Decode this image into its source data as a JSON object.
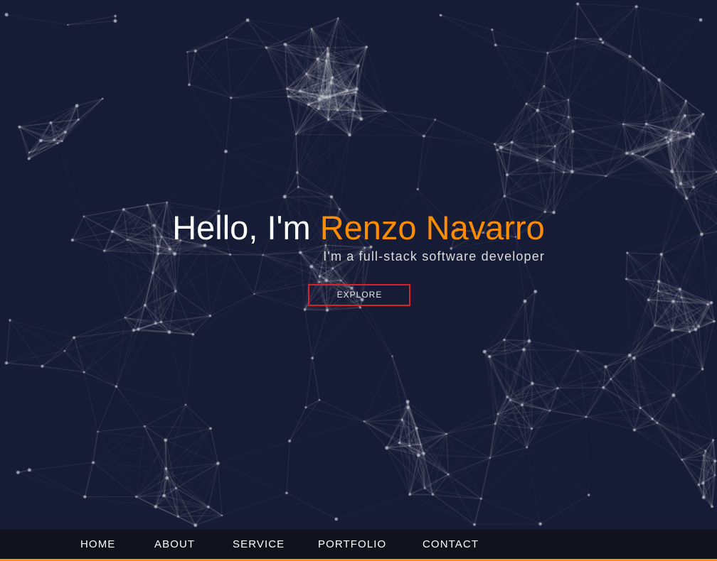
{
  "hero": {
    "greeting": "Hello, I'm",
    "name": "Renzo Navarro",
    "tagline": "I'm a full-stack software developer",
    "cta_label": "EXPLORE"
  },
  "nav": {
    "items": [
      {
        "label": "HOME"
      },
      {
        "label": "ABOUT"
      },
      {
        "label": "SERVICE"
      },
      {
        "label": "PORTFOLIO"
      },
      {
        "label": "CONTACT"
      }
    ]
  },
  "theme": {
    "background": "#161b36",
    "accent": "#ff8c00",
    "button_border": "#d8232a",
    "nav_background": "#10131d",
    "nav_underline": "#f7941e"
  }
}
